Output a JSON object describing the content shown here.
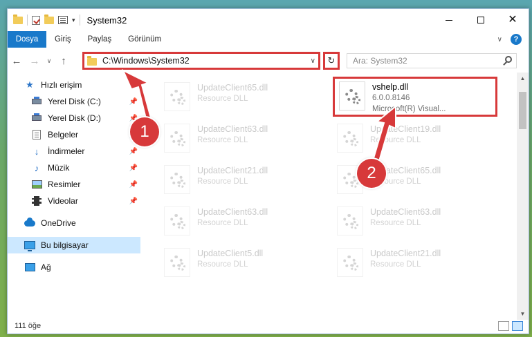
{
  "window": {
    "title": "System32",
    "controls": {
      "minimize": "minimize",
      "maximize": "maximize",
      "close": "✕"
    }
  },
  "ribbon": {
    "tabs": [
      {
        "label": "Dosya",
        "active": true
      },
      {
        "label": "Giriş"
      },
      {
        "label": "Paylaş"
      },
      {
        "label": "Görünüm"
      }
    ],
    "expand_icon": "chevron-down-icon",
    "help": "?"
  },
  "nav": {
    "back": "←",
    "forward": "→",
    "recent": "∨",
    "up": "↑",
    "address": "C:\\Windows\\System32",
    "refresh": "↻",
    "search_placeholder": "Ara: System32"
  },
  "sidebar": {
    "items": [
      {
        "label": "Hızlı erişim",
        "icon": "star-icon"
      },
      {
        "label": "Yerel Disk (C:)",
        "icon": "drive-icon",
        "pinned": true
      },
      {
        "label": "Yerel Disk (D:)",
        "icon": "drive-icon",
        "pinned": true
      },
      {
        "label": "Belgeler",
        "icon": "documents-icon",
        "pinned": true
      },
      {
        "label": "İndirmeler",
        "icon": "downloads-icon",
        "pinned": true
      },
      {
        "label": "Müzik",
        "icon": "music-icon",
        "pinned": true
      },
      {
        "label": "Resimler",
        "icon": "pictures-icon",
        "pinned": true
      },
      {
        "label": "Videolar",
        "icon": "videos-icon",
        "pinned": true
      },
      {
        "label": "OneDrive",
        "icon": "onedrive-icon"
      },
      {
        "label": "Bu bilgisayar",
        "icon": "this-pc-icon",
        "selected": true
      },
      {
        "label": "Ağ",
        "icon": "network-icon"
      }
    ]
  },
  "files": [
    {
      "name": "UpdateClient65.dll",
      "desc": "Resource DLL",
      "faded": true
    },
    {
      "name": "vshelp.dll",
      "version": "6.0.0.8146",
      "company": "Microsoft(R) Visual...",
      "highlighted": true
    },
    {
      "name": "UpdateClient63.dll",
      "desc": "Resource DLL",
      "faded": true
    },
    {
      "name": "UpdateClient19.dll",
      "desc": "Resource DLL",
      "faded": true
    },
    {
      "name": "UpdateClient21.dll",
      "desc": "Resource DLL",
      "faded": true
    },
    {
      "name": "UpdateClient65.dll",
      "desc": "Resource DLL",
      "faded": true
    },
    {
      "name": "UpdateClient63.dll",
      "desc": "Resource DLL",
      "faded": true
    },
    {
      "name": "UpdateClient63.dll",
      "desc": "Resource DLL",
      "faded": true
    },
    {
      "name": "UpdateClient5.dll",
      "desc": "Resource DLL",
      "faded": true
    },
    {
      "name": "UpdateClient21.dll",
      "desc": "Resource DLL",
      "faded": true
    }
  ],
  "status": {
    "count": "111 öğe"
  },
  "annotations": {
    "step1": "1",
    "step2": "2",
    "color": "#d7393a"
  }
}
